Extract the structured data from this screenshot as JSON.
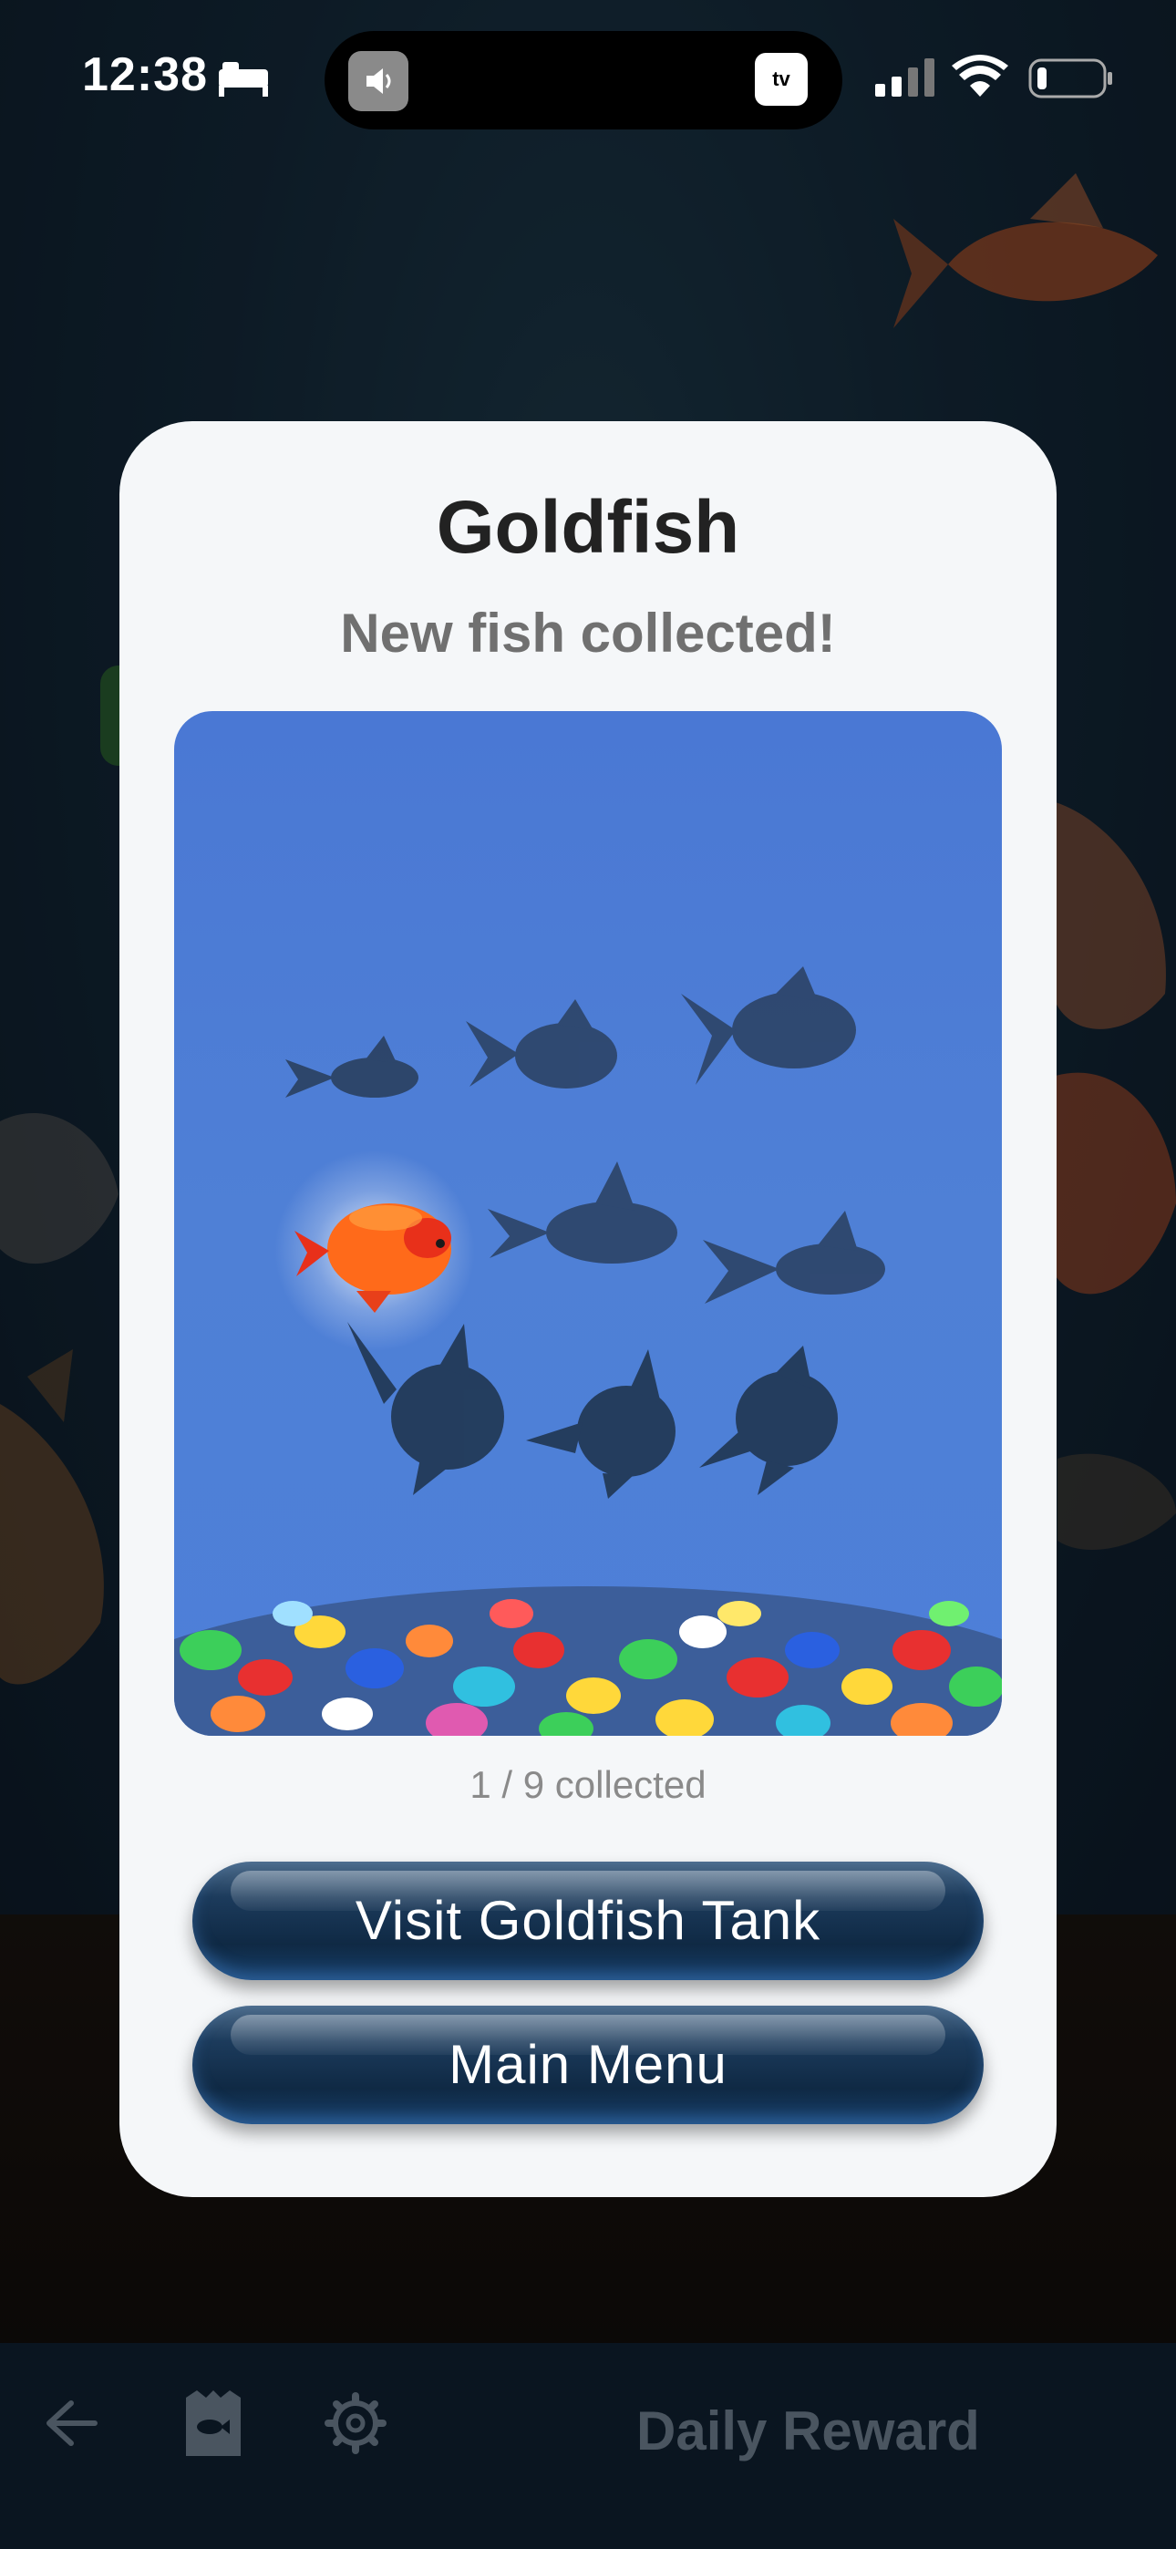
{
  "status_bar": {
    "time": "12:38",
    "tv_label": "tv"
  },
  "modal": {
    "title": "Goldfish",
    "subtitle": "New fish collected!",
    "progress_text": "1 / 9 collected",
    "collected_count": 1,
    "total_count": 9,
    "buttons": {
      "visit": "Visit Goldfish Tank",
      "menu": "Main Menu"
    }
  },
  "bottom_bar": {
    "daily_reward": "Daily Reward"
  },
  "colors": {
    "tank_blue": "#4d7fd8",
    "silhouette": "#2a4060",
    "goldfish_orange": "#ff6a1a",
    "button_navy": "#0f2944"
  }
}
